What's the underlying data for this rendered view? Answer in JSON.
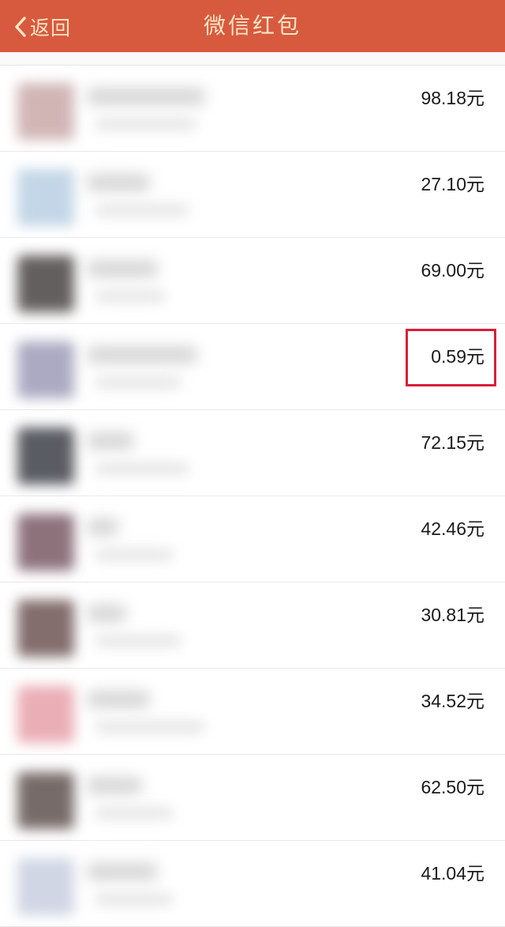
{
  "navbar": {
    "back_label": "返回",
    "title": "微信红包",
    "background": "#d75a3f",
    "text_color": "#fbe4c4"
  },
  "records": [
    {
      "amount": "98.18元",
      "avatar_color": "#c9a9a9"
    },
    {
      "amount": "27.10元",
      "avatar_color": "#b9cfe3"
    },
    {
      "amount": "69.00元",
      "avatar_color": "#4a4444"
    },
    {
      "amount": "0.59元",
      "avatar_color": "#9e9cb8",
      "highlighted": true
    },
    {
      "amount": "72.15元",
      "avatar_color": "#3e4048"
    },
    {
      "amount": "42.46元",
      "avatar_color": "#7a5a66"
    },
    {
      "amount": "30.81元",
      "avatar_color": "#6e5454"
    },
    {
      "amount": "34.52元",
      "avatar_color": "#e7a1aa"
    },
    {
      "amount": "62.50元",
      "avatar_color": "#5f524e"
    },
    {
      "amount": "41.04元",
      "avatar_color": "#c8cfe0"
    }
  ],
  "highlight_color": "#d81e3a"
}
